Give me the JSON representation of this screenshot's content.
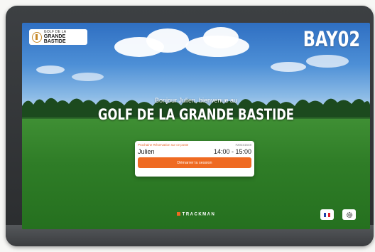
{
  "logo": {
    "line1": "GOLF DE LA",
    "line2": "GRANDE BASTIDE"
  },
  "bay_label": "BAY02",
  "welcome_text": "Bonjour Julien, bienvenue au",
  "course_name": "GOLF DE LA GRANDE BASTIDE",
  "reservation": {
    "label": "Prochaine Réservation sur ce poste",
    "id": "#20231548",
    "name": "Julien",
    "time": "14:00 - 15:00",
    "start_button": "Démarrer la session"
  },
  "footer": {
    "brand": "TRACKMAN"
  },
  "language_icon": "french-flag-icon",
  "settings_icon": "gear-icon",
  "colors": {
    "accent": "#ef6a22",
    "card_bg": "#ffffff",
    "bay_text": "#ffffff"
  }
}
